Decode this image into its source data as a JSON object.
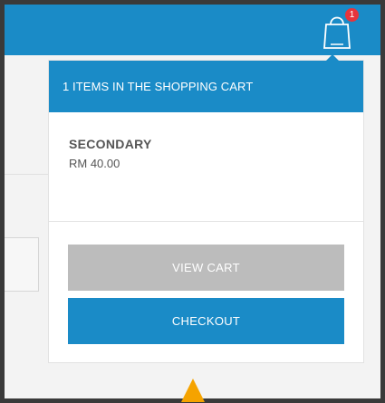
{
  "header": {
    "cart_icon": "shopping-bag-icon",
    "cart_count": "1",
    "badge_color": "#e6343c",
    "bar_color": "#1a8bc7"
  },
  "cart_dropdown": {
    "title": "1  ITEMS IN THE SHOPPING CART",
    "items": [
      {
        "name": "SECONDARY",
        "price": "RM 40.00"
      }
    ],
    "view_cart_label": "VIEW CART",
    "checkout_label": "CHECKOUT"
  },
  "cursor": {
    "icon": "pointer-arrow-icon",
    "color": "#f5a300"
  }
}
